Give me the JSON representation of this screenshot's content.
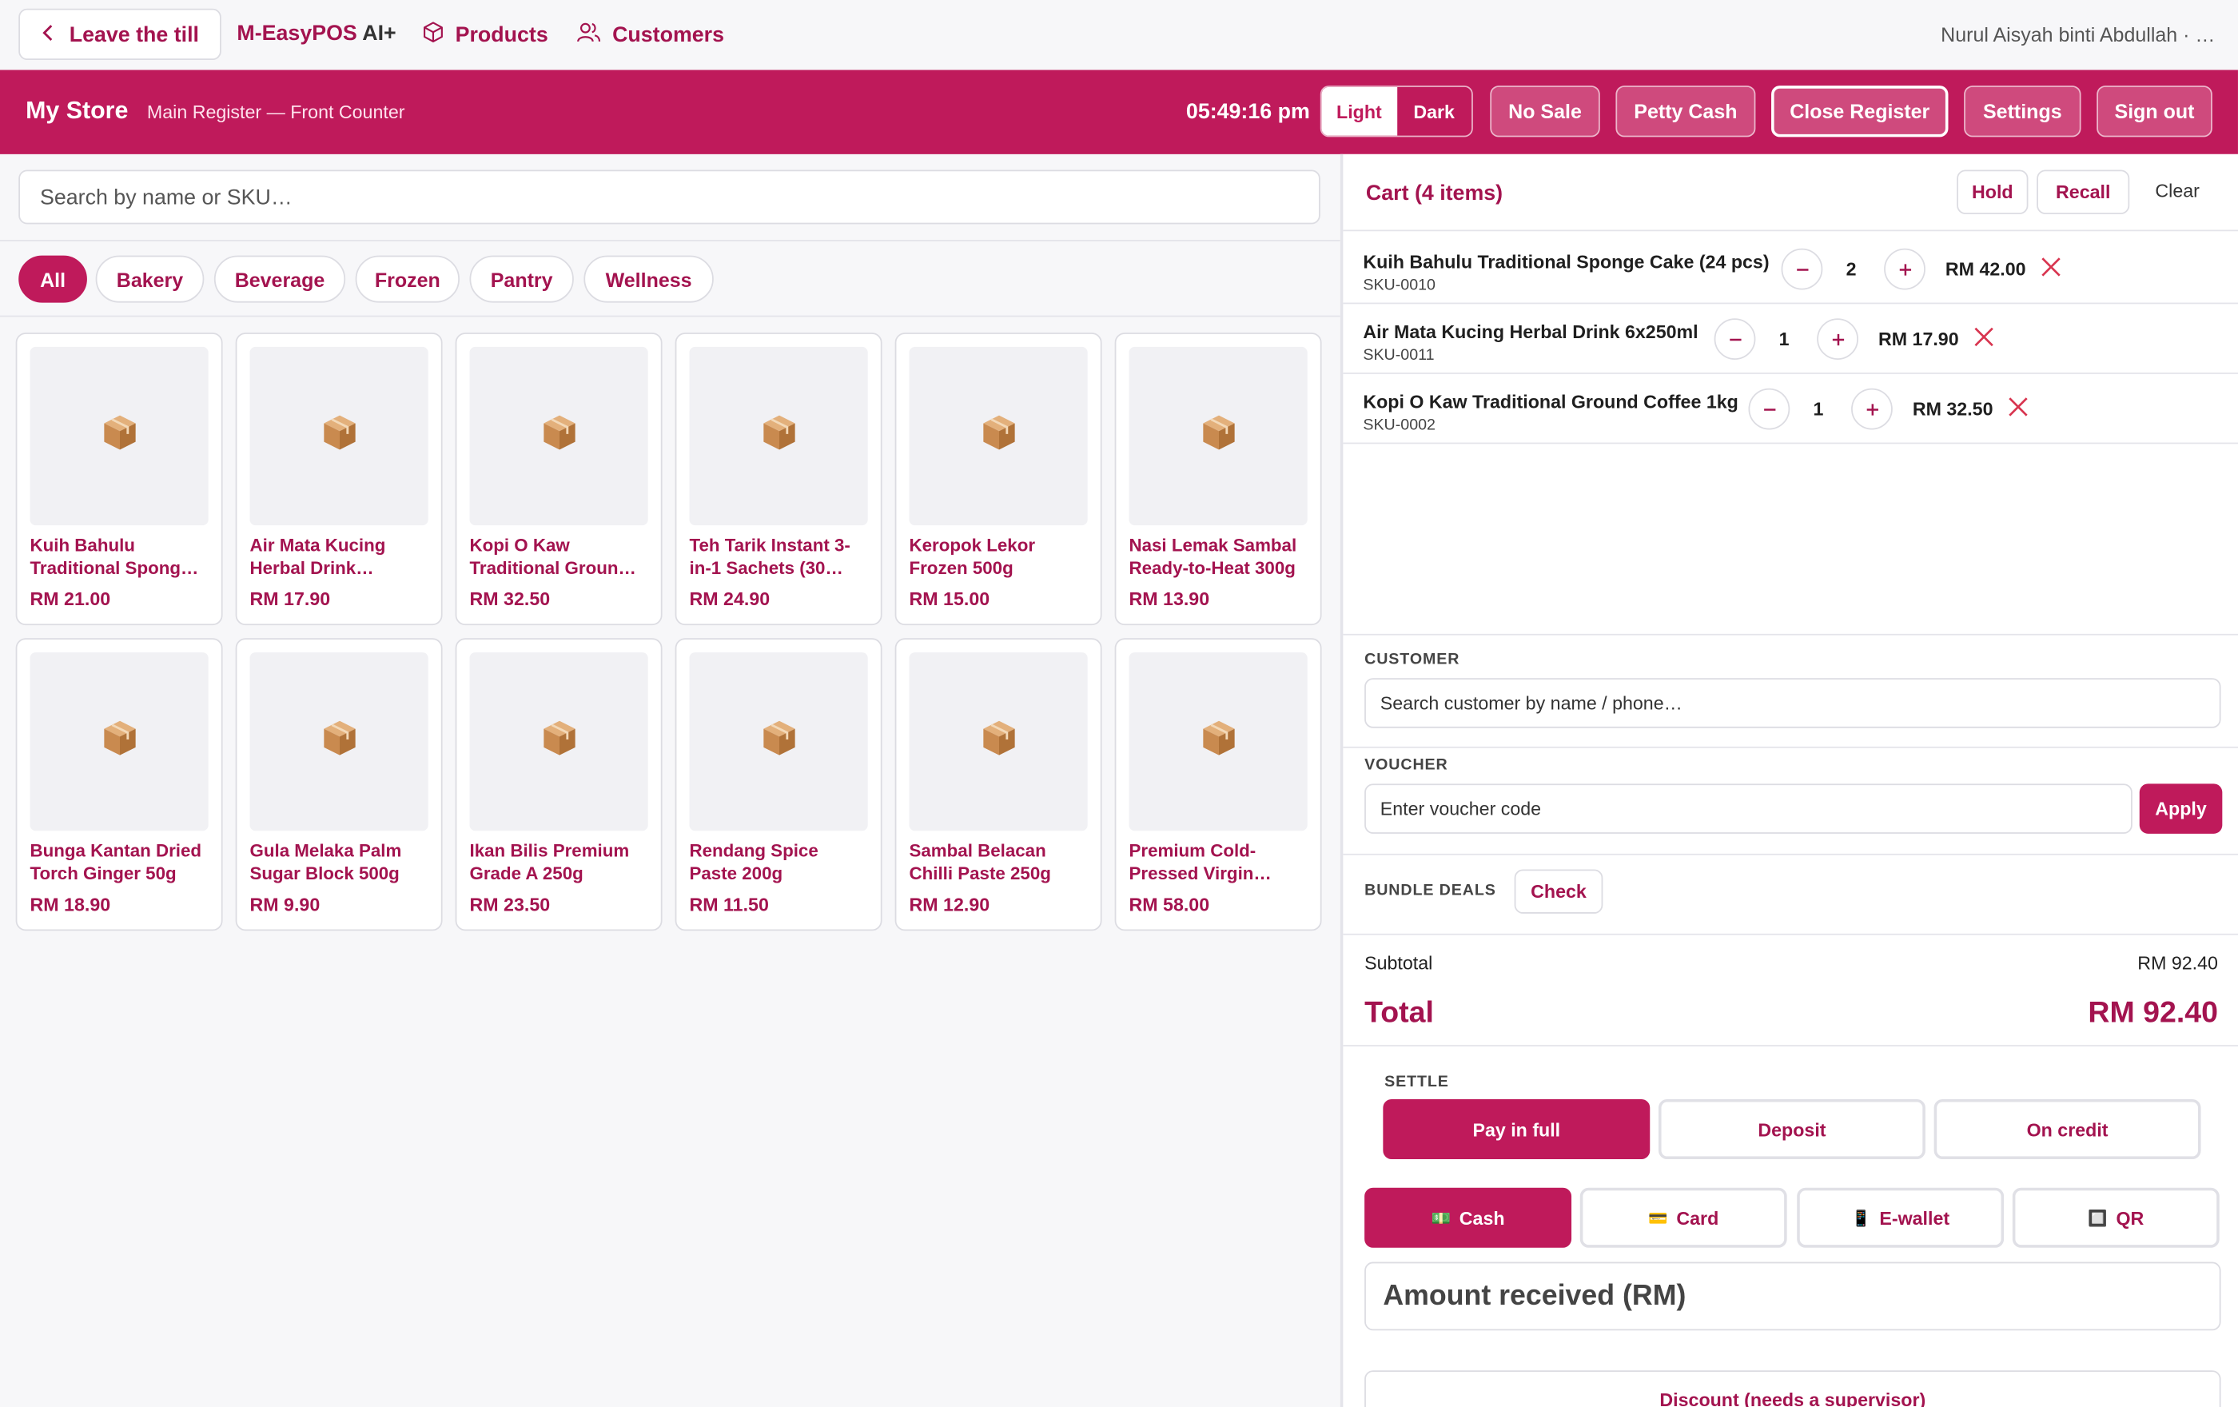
{
  "topnav": {
    "leave_label": "Leave the till",
    "brand": "M-EasyPOS",
    "brand_suffix": "AI+",
    "products_label": "Products",
    "customers_label": "Customers",
    "user": "Nurul Aisyah binti Abdullah · …"
  },
  "header": {
    "store": "My Store",
    "register": "Main Register — Front Counter",
    "clock": "05:49:16 pm",
    "theme_light": "Light",
    "theme_dark": "Dark",
    "no_sale": "No Sale",
    "petty_cash": "Petty Cash",
    "close_register": "Close Register",
    "settings": "Settings",
    "sign_out": "Sign out"
  },
  "catalog": {
    "search_placeholder": "Search by name or SKU…",
    "categories": [
      "All",
      "Bakery",
      "Beverage",
      "Frozen",
      "Pantry",
      "Wellness"
    ],
    "products": [
      {
        "name": "Kuih Bahulu Traditional Spong…",
        "price": "RM 21.00"
      },
      {
        "name": "Air Mata Kucing Herbal Drink…",
        "price": "RM 17.90"
      },
      {
        "name": "Kopi O Kaw Traditional Groun…",
        "price": "RM 32.50"
      },
      {
        "name": "Teh Tarik Instant 3-in-1 Sachets (30…",
        "price": "RM 24.90"
      },
      {
        "name": "Keropok Lekor Frozen 500g",
        "price": "RM 15.00"
      },
      {
        "name": "Nasi Lemak Sambal Ready-to-Heat 300g",
        "price": "RM 13.90"
      },
      {
        "name": "Bunga Kantan Dried Torch Ginger 50g",
        "price": "RM 18.90"
      },
      {
        "name": "Gula Melaka Palm Sugar Block 500g",
        "price": "RM 9.90"
      },
      {
        "name": "Ikan Bilis Premium Grade A 250g",
        "price": "RM 23.50"
      },
      {
        "name": "Rendang Spice Paste 200g",
        "price": "RM 11.50"
      },
      {
        "name": "Sambal Belacan Chilli Paste 250g",
        "price": "RM 12.90"
      },
      {
        "name": "Premium Cold-Pressed Virgin…",
        "price": "RM 58.00"
      }
    ]
  },
  "cart": {
    "title": "Cart (4 items)",
    "hold": "Hold",
    "recall": "Recall",
    "clear": "Clear",
    "items": [
      {
        "name": "Kuih Bahulu Traditional Sponge Cake (24 pcs)",
        "sku": "SKU-0010",
        "qty": "2",
        "price": "RM 42.00"
      },
      {
        "name": "Air Mata Kucing Herbal Drink 6x250ml",
        "sku": "SKU-0011",
        "qty": "1",
        "price": "RM 17.90"
      },
      {
        "name": "Kopi O Kaw Traditional Ground Coffee 1kg",
        "sku": "SKU-0002",
        "qty": "1",
        "price": "RM 32.50"
      }
    ],
    "customer_label": "CUSTOMER",
    "customer_placeholder": "Search customer by name / phone…",
    "voucher_label": "VOUCHER",
    "voucher_placeholder": "Enter voucher code",
    "apply": "Apply",
    "bundle_label": "BUNDLE DEALS",
    "check": "Check",
    "subtotal_label": "Subtotal",
    "subtotal": "RM 92.40",
    "total_label": "Total",
    "total": "RM 92.40",
    "settle_label": "SETTLE",
    "settle_options": [
      "Pay in full",
      "Deposit",
      "On credit"
    ],
    "pay_methods": [
      {
        "icon": "💵",
        "label": "Cash"
      },
      {
        "icon": "💳",
        "label": "Card"
      },
      {
        "icon": "📱",
        "label": "E-wallet"
      },
      {
        "icon": "🔲",
        "label": "QR"
      }
    ],
    "amount_placeholder": "Amount received (RM)",
    "discount": "Discount (needs a supervisor)"
  },
  "colors": {
    "accent": "#bf1a5b",
    "accent_text": "#a3134f"
  }
}
